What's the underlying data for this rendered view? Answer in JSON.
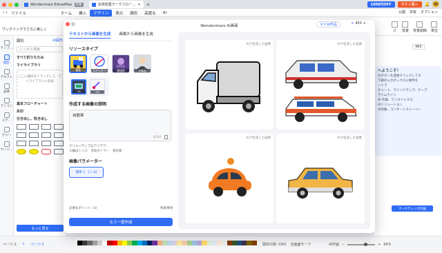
{
  "titlebar": {
    "tabs": [
      {
        "label": "Wondershare EdrawMax",
        "tag": "専業"
      },
      {
        "label": "決済処理ワークフロー..."
      }
    ],
    "offer": "1000円OFF",
    "buy": "今すぐ購入",
    "avatar": "W"
  },
  "menu": {
    "items": [
      "ファイル",
      "ホーム",
      "挿入",
      "デザイン",
      "表示",
      "図形",
      "高度な",
      "AI"
    ],
    "active_index": 3,
    "right": [
      "公開",
      "共有",
      "オプション"
    ]
  },
  "ribbon": {
    "left_text": "ワンクリックでさらに美しく",
    "right": [
      "ズ",
      "背景",
      "背景削除",
      "単位"
    ]
  },
  "rail": [
    "テンプ...",
    "図形",
    "テキスト",
    "画像",
    "アイコン",
    "ステ...",
    "チャー",
    "ウィジ..."
  ],
  "shapes_panel": {
    "title": "図形",
    "ai_badge": "AI図形",
    "search_placeholder": "シンボル検索",
    "all_shapes": "すべて折りたたみ",
    "my_library": "マイライブラリ",
    "library_hint": "ここに図形をドラッグして、マイライブラリに追加",
    "basic_flow": "基本フローチャート",
    "arrows": "矢印",
    "rich": "引き出し、吹き出し",
    "show_more": "もっと見る"
  },
  "dialog": {
    "title": "Wondershare AI画商",
    "my_work": "マイAI作品",
    "credits": "450",
    "tabs": [
      "テキストから画像を生成",
      "画像から画像を生成"
    ],
    "active_tab": 0,
    "style_label": "リソースタイプ",
    "styles": [
      {
        "name": "漫画",
        "selected": true
      },
      {
        "name": "ステッカー",
        "selected": false
      },
      {
        "name": "線描画",
        "selected": false
      },
      {
        "name": "肖像画",
        "selected": false
      }
    ],
    "sub_styles": [
      {
        "name": "3D",
        "selected": true
      },
      {
        "name": "2D",
        "selected": false
      }
    ],
    "prompt_label": "作成する画像の説明",
    "prompt_value": "自動車",
    "prompt_count": "4/500",
    "ideas_label": "クリエイティブなアイデア:",
    "ideas": "三輪ぽくバス　涼気ボイラー　滑水艇",
    "param_label": "画像パラメーター",
    "param_value": "標準 1 : 1 / 30",
    "points": "必要なポイント: 10",
    "terms": "免責事項",
    "regenerate": "もう一度作成",
    "result_tag": "AIが生成した画像",
    "results_count": 4
  },
  "right_panel": {
    "badge": "460",
    "welcome_title": "へようこそ！",
    "welcome_lines": [
      "のボタンを直接クリックしてす",
      "下部の入力ボックスに要件を",
      "ートで",
      "チャート、マインドマップ、ケープ",
      "ライムライン",
      "",
      "AI 作業、ワンクリックス",
      "",
      "AIソリューション",
      "",
      "AI作業、コンサートストーリー"
    ],
    "marketing": "マーケティング計画"
  },
  "status": {
    "pages": [
      "ページ-1",
      "ページ-1"
    ],
    "shape_count": "図形の数: 0/60",
    "fullscreen": "全画面モード",
    "ai_panel": "AI作画",
    "zoom": "66%"
  },
  "palette": [
    "#000000",
    "#3b3b3b",
    "#6e6e6e",
    "#a3a3a3",
    "#d4d4d4",
    "#ffffff",
    "#c00000",
    "#ff0000",
    "#ffc000",
    "#ffff00",
    "#92d050",
    "#00b050",
    "#00b0f0",
    "#0070c0",
    "#002060",
    "#7030a0",
    "#f4b183",
    "#c5e0b4",
    "#bdd7ee",
    "#d9d2e9",
    "#ffe699",
    "#f8cbad",
    "#a9d18e",
    "#9dc3e6",
    "#b4a7d6",
    "#ffd966",
    "#e2efda",
    "#ddebf7",
    "#fce4d6",
    "#ededed",
    "#833c0b",
    "#385723",
    "#1f4e79",
    "#3f3151",
    "#7f6000",
    "#843c0c"
  ]
}
